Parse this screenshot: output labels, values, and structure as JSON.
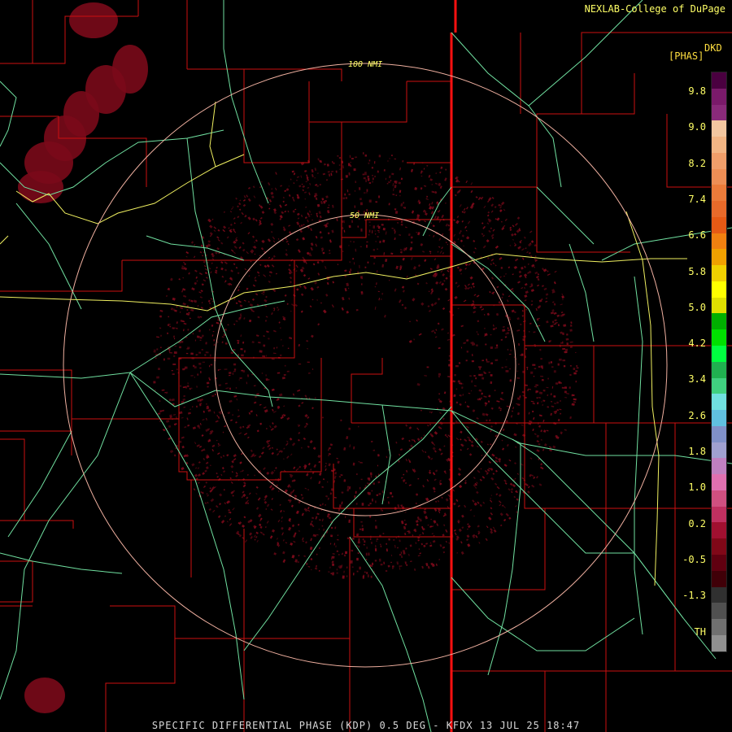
{
  "header": {
    "credit": "NEXLAB-College of DuPage"
  },
  "footer": {
    "caption": "SPECIFIC DIFFERENTIAL PHASE (KDP) 0.5 DEG - KFDX 13 JUL 25 18:47"
  },
  "rings": {
    "inner_label": "50 NMI",
    "outer_label": "100 NMI"
  },
  "legend": {
    "product": "DKD",
    "unit": "[PHAS]",
    "ticks": [
      "9.8",
      "9.0",
      "8.2",
      "7.4",
      "6.6",
      "5.8",
      "5.0",
      "4.2",
      "3.4",
      "2.6",
      "1.8",
      "1.0",
      "0.2",
      "-0.5",
      "-1.3",
      "TH"
    ],
    "colors": [
      "#4a0040",
      "#7a1a6a",
      "#8a2a7a",
      "#f3c7a0",
      "#f2b584",
      "#f09e6a",
      "#ee8e55",
      "#ec7b3a",
      "#e86a2a",
      "#e65a15",
      "#f08010",
      "#f0a000",
      "#f0d000",
      "#ffff00",
      "#e0e000",
      "#00b000",
      "#00e000",
      "#00ff40",
      "#20b050",
      "#40d080",
      "#70e0e0",
      "#60c0e0",
      "#8090c8",
      "#a0a0d0",
      "#c080c0",
      "#e070b0",
      "#d05080",
      "#c03060",
      "#a01030",
      "#800818",
      "#600010",
      "#400008",
      "#303030",
      "#505050",
      "#707070",
      "#909090"
    ]
  },
  "colors": {
    "background": "#000000",
    "county_lines": "#cc1010",
    "state_line": "#ff1010",
    "roads": "#70e0a0",
    "highways": "#f0f060",
    "rings": "#f0b0a0",
    "echo": "#7a0a1a"
  }
}
